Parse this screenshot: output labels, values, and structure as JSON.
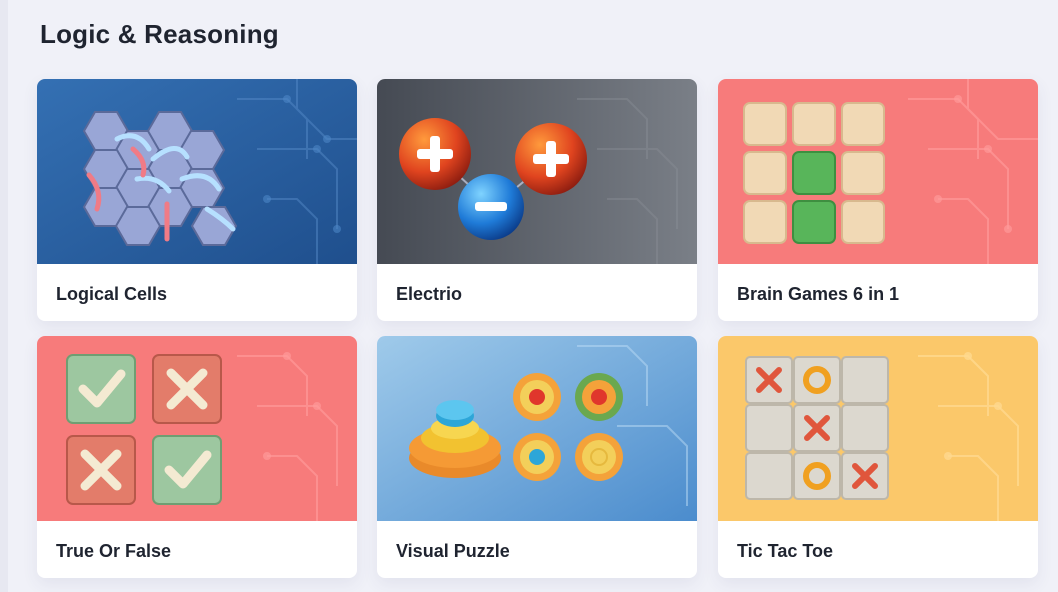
{
  "section": {
    "title": "Logic & Reasoning"
  },
  "games": [
    {
      "title": "Logical Cells",
      "icon": "hexagon-cells-icon",
      "bg": "#2e63a3"
    },
    {
      "title": "Electrio",
      "icon": "charged-particles-icon",
      "bg": "#4a4f58"
    },
    {
      "title": "Brain Games 6 in 1",
      "icon": "tile-grid-icon",
      "bg": "#f77b7b"
    },
    {
      "title": "True Or False",
      "icon": "check-cross-tiles-icon",
      "bg": "#f77b7b"
    },
    {
      "title": "Visual Puzzle",
      "icon": "ring-stack-icon",
      "bg": "#7fb3dd"
    },
    {
      "title": "Tic Tac Toe",
      "icon": "tic-tac-toe-board-icon",
      "bg": "#fbc86a"
    }
  ]
}
